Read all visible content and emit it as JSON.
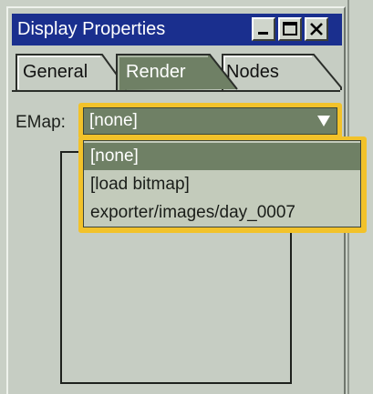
{
  "window": {
    "title": "Display Properties"
  },
  "tabs": [
    {
      "label": "General",
      "active": false
    },
    {
      "label": "Render",
      "active": true
    },
    {
      "label": "Nodes",
      "active": false
    }
  ],
  "emap": {
    "label": "EMap:",
    "selected_value": "[none]",
    "options": [
      {
        "label": "[none]",
        "selected": true
      },
      {
        "label": "[load bitmap]",
        "selected": false
      },
      {
        "label": "exporter/images/day_0007",
        "selected": false
      }
    ]
  },
  "colors": {
    "titlebar": "#1a2f8e",
    "focus_ring": "#f2c22a",
    "selection": "#6f8065",
    "panel": "#c6cdc3"
  },
  "icons": {
    "minimize": "minimize-icon",
    "maximize": "maximize-icon",
    "close": "close-icon",
    "dropdown": "chevron-down-icon"
  }
}
